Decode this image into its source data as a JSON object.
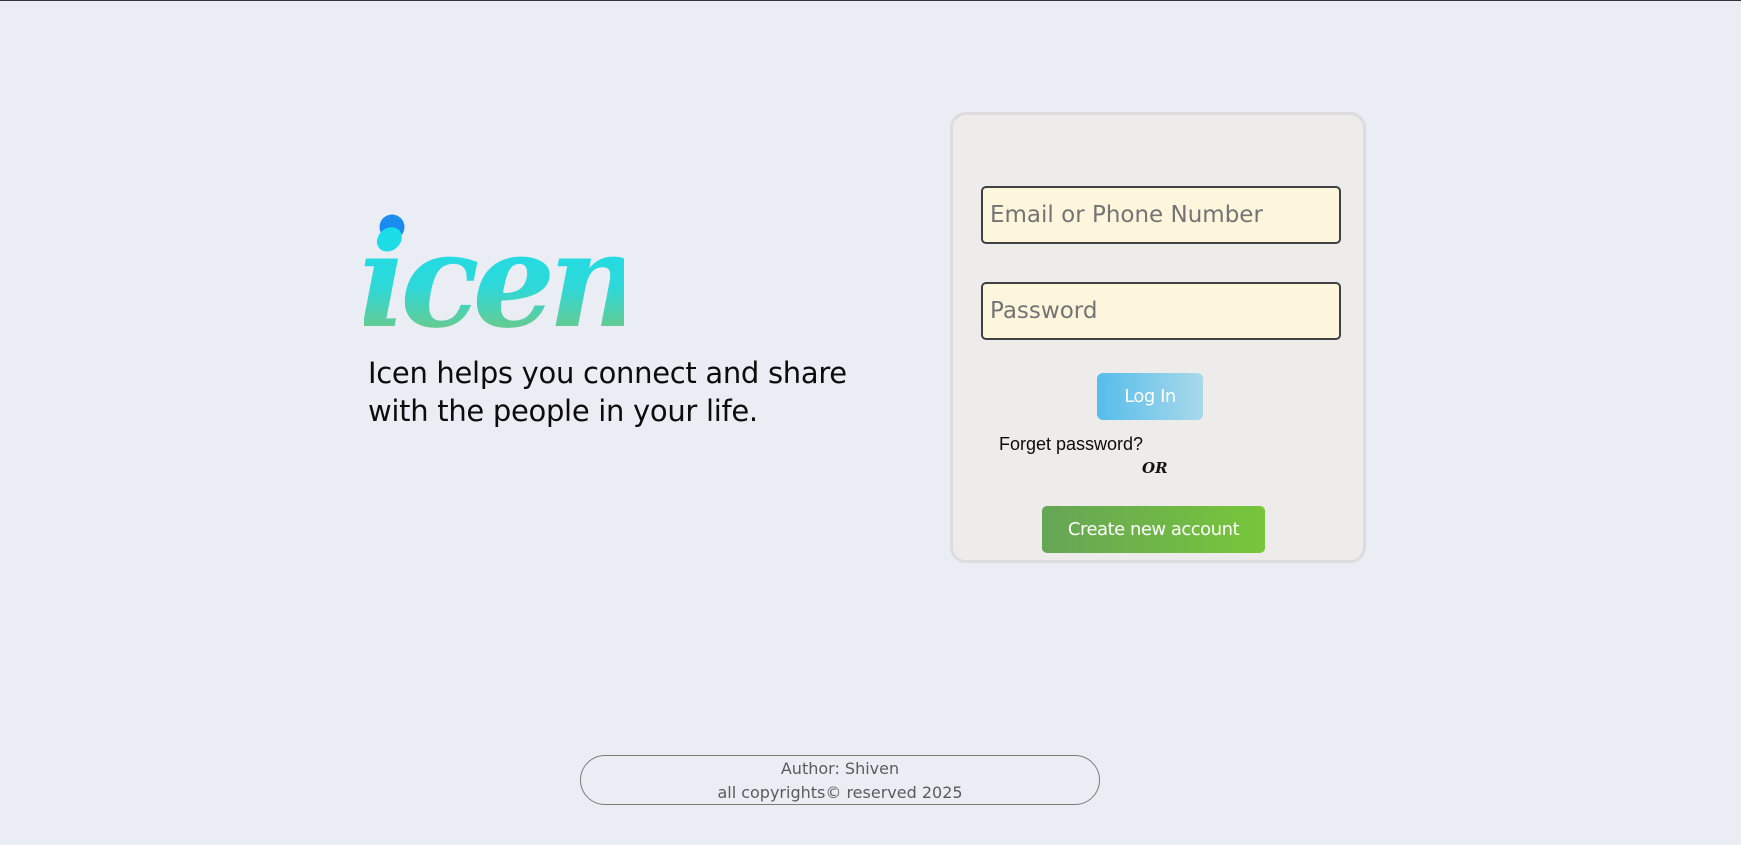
{
  "brand": {
    "logo_text": "icen",
    "tagline_line1": "Icen helps you connect and share",
    "tagline_line2": "with the people in your life."
  },
  "login": {
    "email_placeholder": "Email or Phone Number",
    "password_placeholder": "Password",
    "login_label": "Log In",
    "forgot_label": "Forget password?",
    "or_label": "OR",
    "create_label": "Create new account"
  },
  "footer": {
    "author": "Author: Shiven",
    "copyright": "all copyrights© reserved 2025"
  },
  "colors": {
    "page_background": "#eaedf4",
    "card_background": "#edecea",
    "input_background": "#fdf6dd",
    "login_button": "#56bdeb",
    "create_button": "#6fba45",
    "logo_gradient_top": "#0fd8f0",
    "logo_gradient_bottom": "#8ec25d",
    "logo_dot": "#1a8cf0"
  }
}
